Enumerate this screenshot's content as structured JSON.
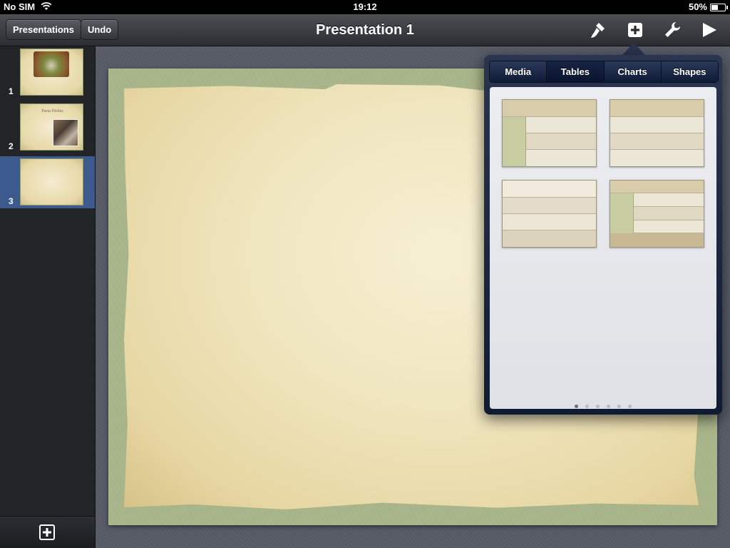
{
  "status_bar": {
    "carrier": "No SIM",
    "time": "19:12",
    "battery_percent": "50%",
    "battery_level": 0.5
  },
  "toolbar": {
    "presentations_label": "Presentations",
    "undo_label": "Undo",
    "title": "Presentation 1",
    "icons": [
      "paintbrush-icon",
      "insert-icon",
      "wrench-icon",
      "play-icon"
    ]
  },
  "slides": [
    {
      "number": "1"
    },
    {
      "number": "2",
      "title": "Pasta Dishes"
    },
    {
      "number": "3"
    }
  ],
  "selected_slide": 3,
  "insert_popover": {
    "tabs": [
      "Media",
      "Tables",
      "Charts",
      "Shapes"
    ],
    "active_tab": "Tables",
    "page_count": 6,
    "active_page": 1
  }
}
